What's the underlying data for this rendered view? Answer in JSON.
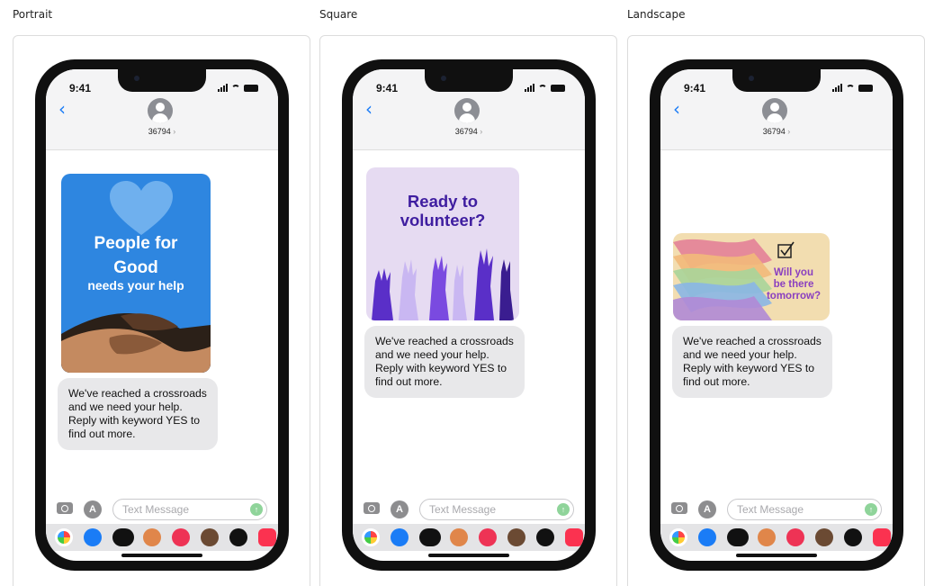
{
  "columns": [
    {
      "title": "Portrait"
    },
    {
      "title": "Square"
    },
    {
      "title": "Landscape"
    }
  ],
  "phone": {
    "time": "9:41",
    "contact_number": "36794",
    "contact_chevron": "›",
    "back_icon": "chevron-left-icon",
    "composer_placeholder": "Text Message",
    "send_icon": "arrow-up-icon",
    "apps_icon_glyph": "A",
    "send_glyph": "↑"
  },
  "message": {
    "body": "We've reached a crossroads and we need your help. Reply with keyword YES to find out more."
  },
  "images": {
    "portrait": {
      "line1": "People for",
      "line2": "Good",
      "line3": "needs your help"
    },
    "square": {
      "line1": "Ready to",
      "line2": "volunteer?"
    },
    "landscape": {
      "line1": "Will you",
      "line2": "be there",
      "line3": "tomorrow?"
    }
  },
  "app_drawer": [
    "photos-icon",
    "app-store-icon",
    "apple-pay-icon",
    "memoji-icon",
    "image-search-icon",
    "memoji-2-icon",
    "heart-sticker-icon",
    "music-icon"
  ],
  "colors": {
    "ios_blue": "#1a7cf6",
    "bubble_gray": "#e8e8ea",
    "portrait_bg": "#2e86e0",
    "square_bg": "#e6dbf2",
    "square_text": "#3f1ea0",
    "landscape_bg": "#f2ddb0",
    "landscape_text": "#8a3fc0"
  }
}
